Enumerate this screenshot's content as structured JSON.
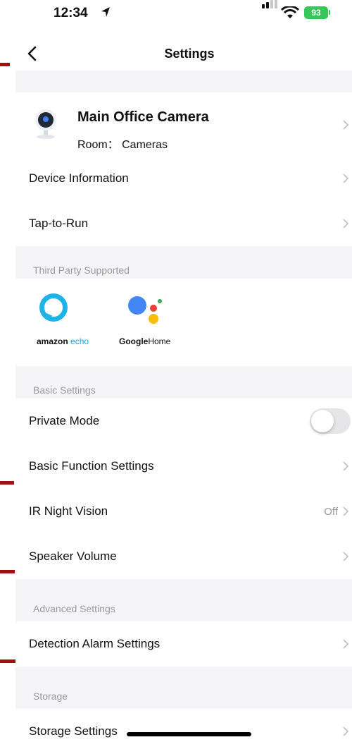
{
  "status_bar": {
    "time": "12:34",
    "battery": "93"
  },
  "nav": {
    "title": "Settings"
  },
  "device": {
    "name": "Main Office Camera",
    "room": "Room： Cameras"
  },
  "rows_top": [
    {
      "label": "Device Information"
    },
    {
      "label": "Tap-to-Run"
    }
  ],
  "third_party": {
    "section_label": "Third Party Supported",
    "alexa": {
      "brand": "amazon",
      "product": "echo"
    },
    "google": {
      "brand": "Google",
      "product": "Home"
    }
  },
  "basic": {
    "section_label": "Basic Settings",
    "private_mode": {
      "label": "Private Mode",
      "on": false
    },
    "basic_function": {
      "label": "Basic Function Settings"
    },
    "ir_night": {
      "label": "IR Night Vision",
      "value": "Off"
    },
    "speaker": {
      "label": "Speaker Volume"
    }
  },
  "advanced": {
    "section_label": "Advanced Settings",
    "detection": {
      "label": "Detection Alarm Settings"
    }
  },
  "storage": {
    "section_label": "Storage",
    "row_label": "Storage Settings"
  },
  "colors": {
    "accent_red": "#a01010",
    "toggle_off": "#e6e6e8",
    "battery": "#34c759"
  }
}
